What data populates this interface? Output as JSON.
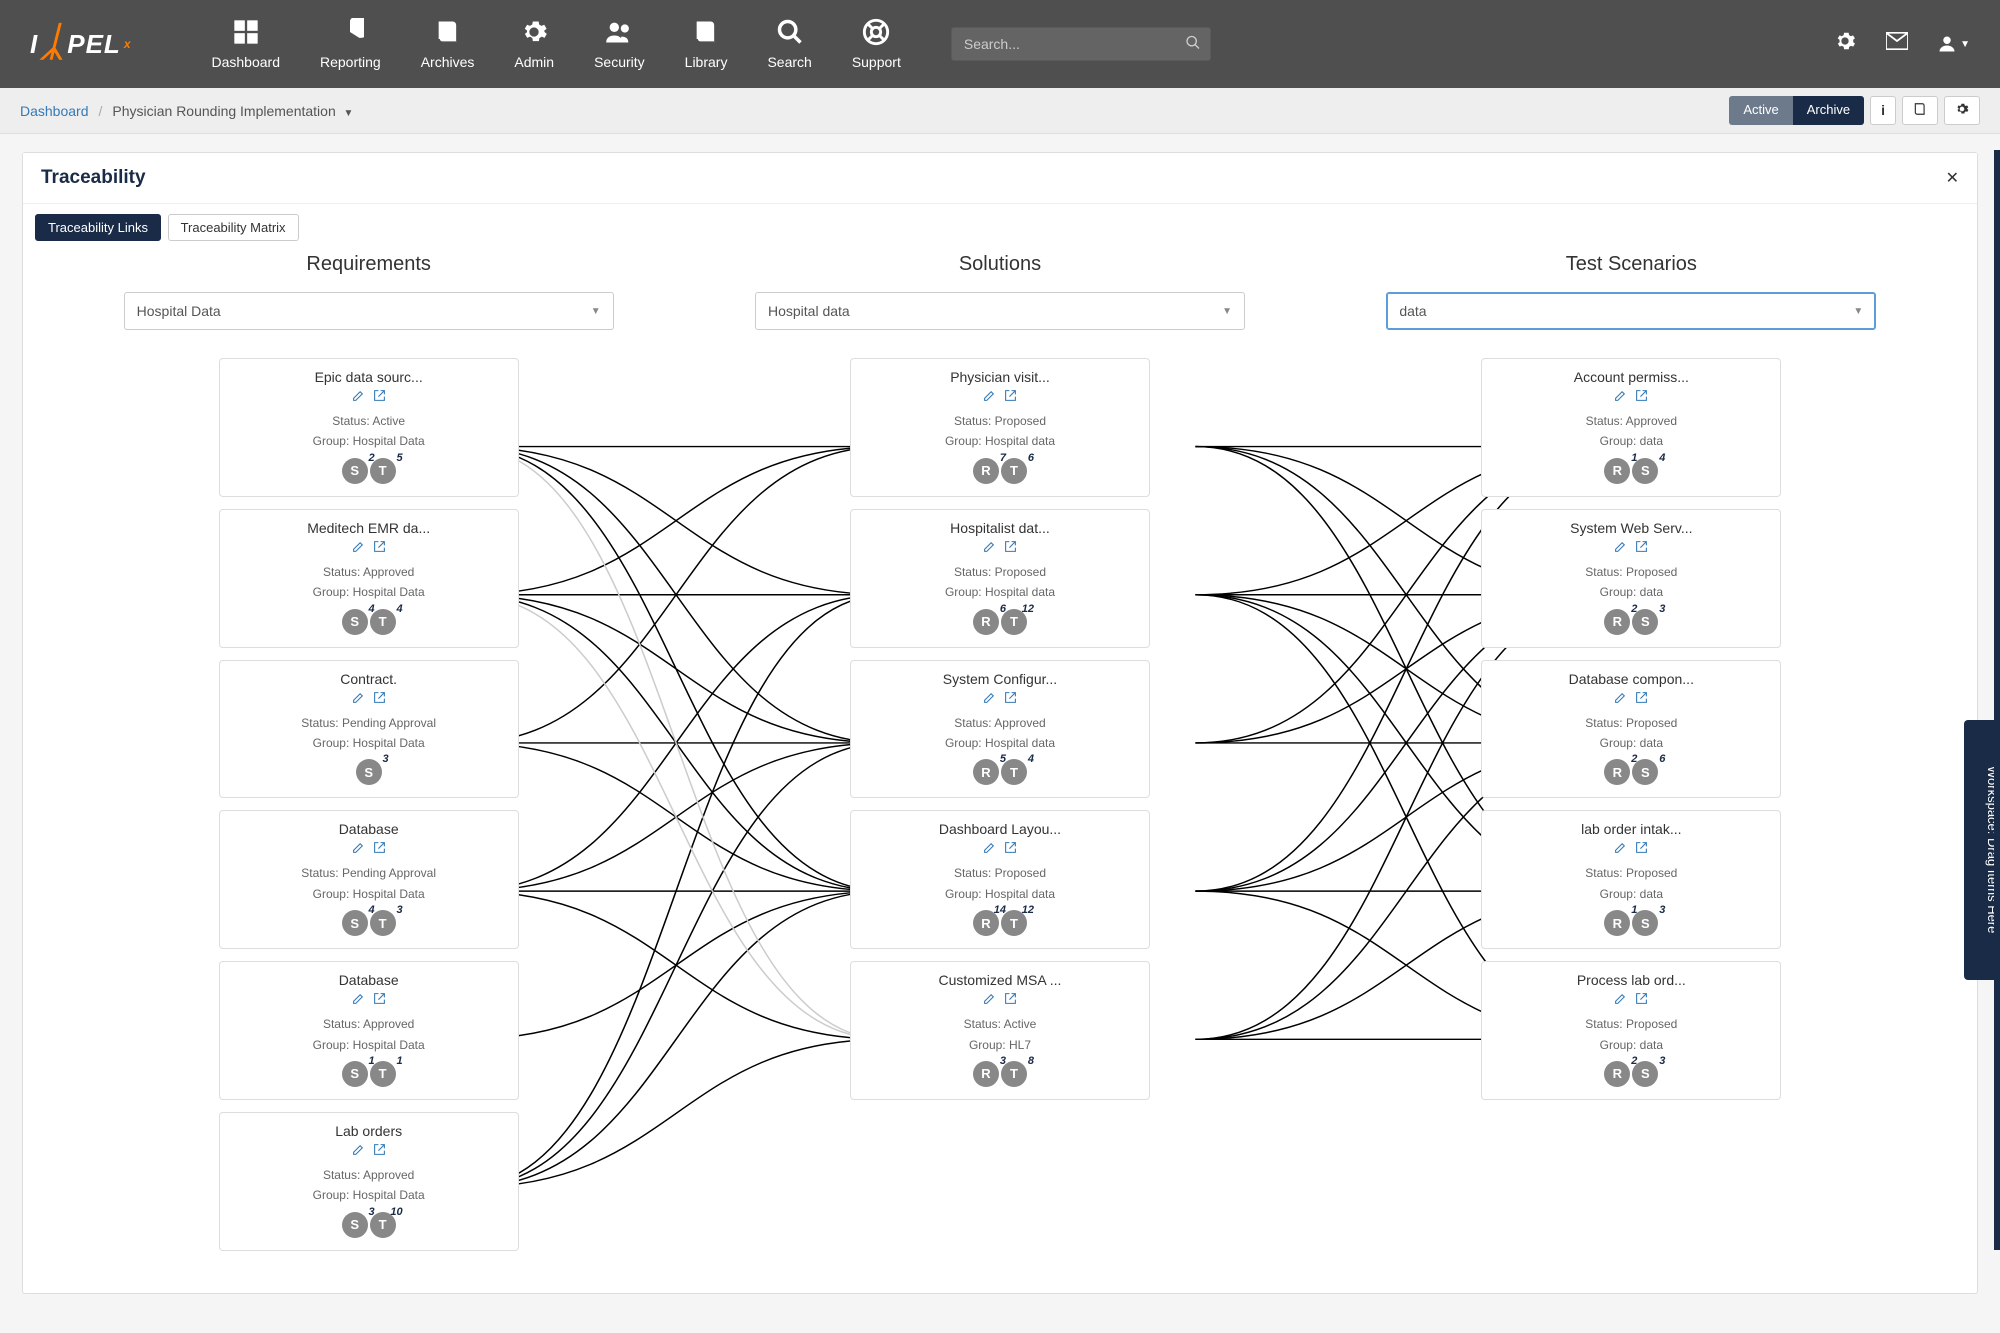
{
  "brand": {
    "name": "IMPEL",
    "sup": "x"
  },
  "nav": [
    {
      "label": "Dashboard",
      "icon": "grid"
    },
    {
      "label": "Reporting",
      "icon": "pie"
    },
    {
      "label": "Archives",
      "icon": "book"
    },
    {
      "label": "Admin",
      "icon": "gear"
    },
    {
      "label": "Security",
      "icon": "users"
    },
    {
      "label": "Library",
      "icon": "book"
    },
    {
      "label": "Search",
      "icon": "search"
    },
    {
      "label": "Support",
      "icon": "life-ring"
    }
  ],
  "search": {
    "placeholder": "Search..."
  },
  "breadcrumbs": {
    "root": "Dashboard",
    "current": "Physician Rounding Implementation"
  },
  "state_tabs": {
    "active": "Active",
    "archive": "Archive"
  },
  "panel": {
    "title": "Traceability"
  },
  "tabs": {
    "t1": "Traceability Links",
    "t2": "Traceability Matrix"
  },
  "columns": {
    "req": {
      "title": "Requirements",
      "dd": "Hospital Data",
      "cards": [
        {
          "title": "Epic data sourc...",
          "status": "Active",
          "group": "Hospital Data",
          "badges": [
            {
              "l": "S",
              "n": "2"
            },
            {
              "l": "T",
              "n": "5"
            }
          ]
        },
        {
          "title": "Meditech EMR da...",
          "status": "Approved",
          "group": "Hospital Data",
          "badges": [
            {
              "l": "S",
              "n": "4"
            },
            {
              "l": "T",
              "n": "4"
            }
          ]
        },
        {
          "title": "Contract.",
          "status": "Pending Approval",
          "group": "Hospital Data",
          "badges": [
            {
              "l": "S",
              "n": "3"
            }
          ]
        },
        {
          "title": "Database",
          "status": "Pending Approval",
          "group": "Hospital Data",
          "badges": [
            {
              "l": "S",
              "n": "4"
            },
            {
              "l": "T",
              "n": "3"
            }
          ]
        },
        {
          "title": "Database",
          "status": "Approved",
          "group": "Hospital Data",
          "badges": [
            {
              "l": "S",
              "n": "1"
            },
            {
              "l": "T",
              "n": "1"
            }
          ]
        },
        {
          "title": "Lab orders",
          "status": "Approved",
          "group": "Hospital Data",
          "badges": [
            {
              "l": "S",
              "n": "3"
            },
            {
              "l": "T",
              "n": "10"
            }
          ]
        }
      ]
    },
    "sol": {
      "title": "Solutions",
      "dd": "Hospital data",
      "cards": [
        {
          "title": "Physician visit...",
          "status": "Proposed",
          "group": "Hospital data",
          "badges": [
            {
              "l": "R",
              "n": "7"
            },
            {
              "l": "T",
              "n": "6"
            }
          ]
        },
        {
          "title": "Hospitalist dat...",
          "status": "Proposed",
          "group": "Hospital data",
          "badges": [
            {
              "l": "R",
              "n": "6"
            },
            {
              "l": "T",
              "n": "12"
            }
          ]
        },
        {
          "title": "System Configur...",
          "status": "Approved",
          "group": "Hospital data",
          "badges": [
            {
              "l": "R",
              "n": "5"
            },
            {
              "l": "T",
              "n": "4"
            }
          ]
        },
        {
          "title": "Dashboard Layou...",
          "status": "Proposed",
          "group": "Hospital data",
          "badges": [
            {
              "l": "R",
              "n": "14"
            },
            {
              "l": "T",
              "n": "12"
            }
          ]
        },
        {
          "title": "Customized MSA ...",
          "status": "Active",
          "group": "HL7",
          "badges": [
            {
              "l": "R",
              "n": "3"
            },
            {
              "l": "T",
              "n": "8"
            }
          ]
        }
      ]
    },
    "test": {
      "title": "Test Scenarios",
      "dd": "data",
      "cards": [
        {
          "title": "Account permiss...",
          "status": "Approved",
          "group": "data",
          "badges": [
            {
              "l": "R",
              "n": "1"
            },
            {
              "l": "S",
              "n": "4"
            }
          ]
        },
        {
          "title": "System Web Serv...",
          "status": "Proposed",
          "group": "data",
          "badges": [
            {
              "l": "R",
              "n": "2"
            },
            {
              "l": "S",
              "n": "3"
            }
          ]
        },
        {
          "title": "Database compon...",
          "status": "Proposed",
          "group": "data",
          "badges": [
            {
              "l": "R",
              "n": "2"
            },
            {
              "l": "S",
              "n": "6"
            }
          ]
        },
        {
          "title": "lab order intak...",
          "status": "Proposed",
          "group": "data",
          "badges": [
            {
              "l": "R",
              "n": "1"
            },
            {
              "l": "S",
              "n": "3"
            }
          ]
        },
        {
          "title": "Process lab ord...",
          "status": "Proposed",
          "group": "data",
          "badges": [
            {
              "l": "R",
              "n": "2"
            },
            {
              "l": "S",
              "n": "3"
            }
          ]
        }
      ]
    }
  },
  "side_tab": "Workspace: Drag Items Here",
  "labels": {
    "status_prefix": "Status:",
    "group_prefix": "Group:"
  }
}
